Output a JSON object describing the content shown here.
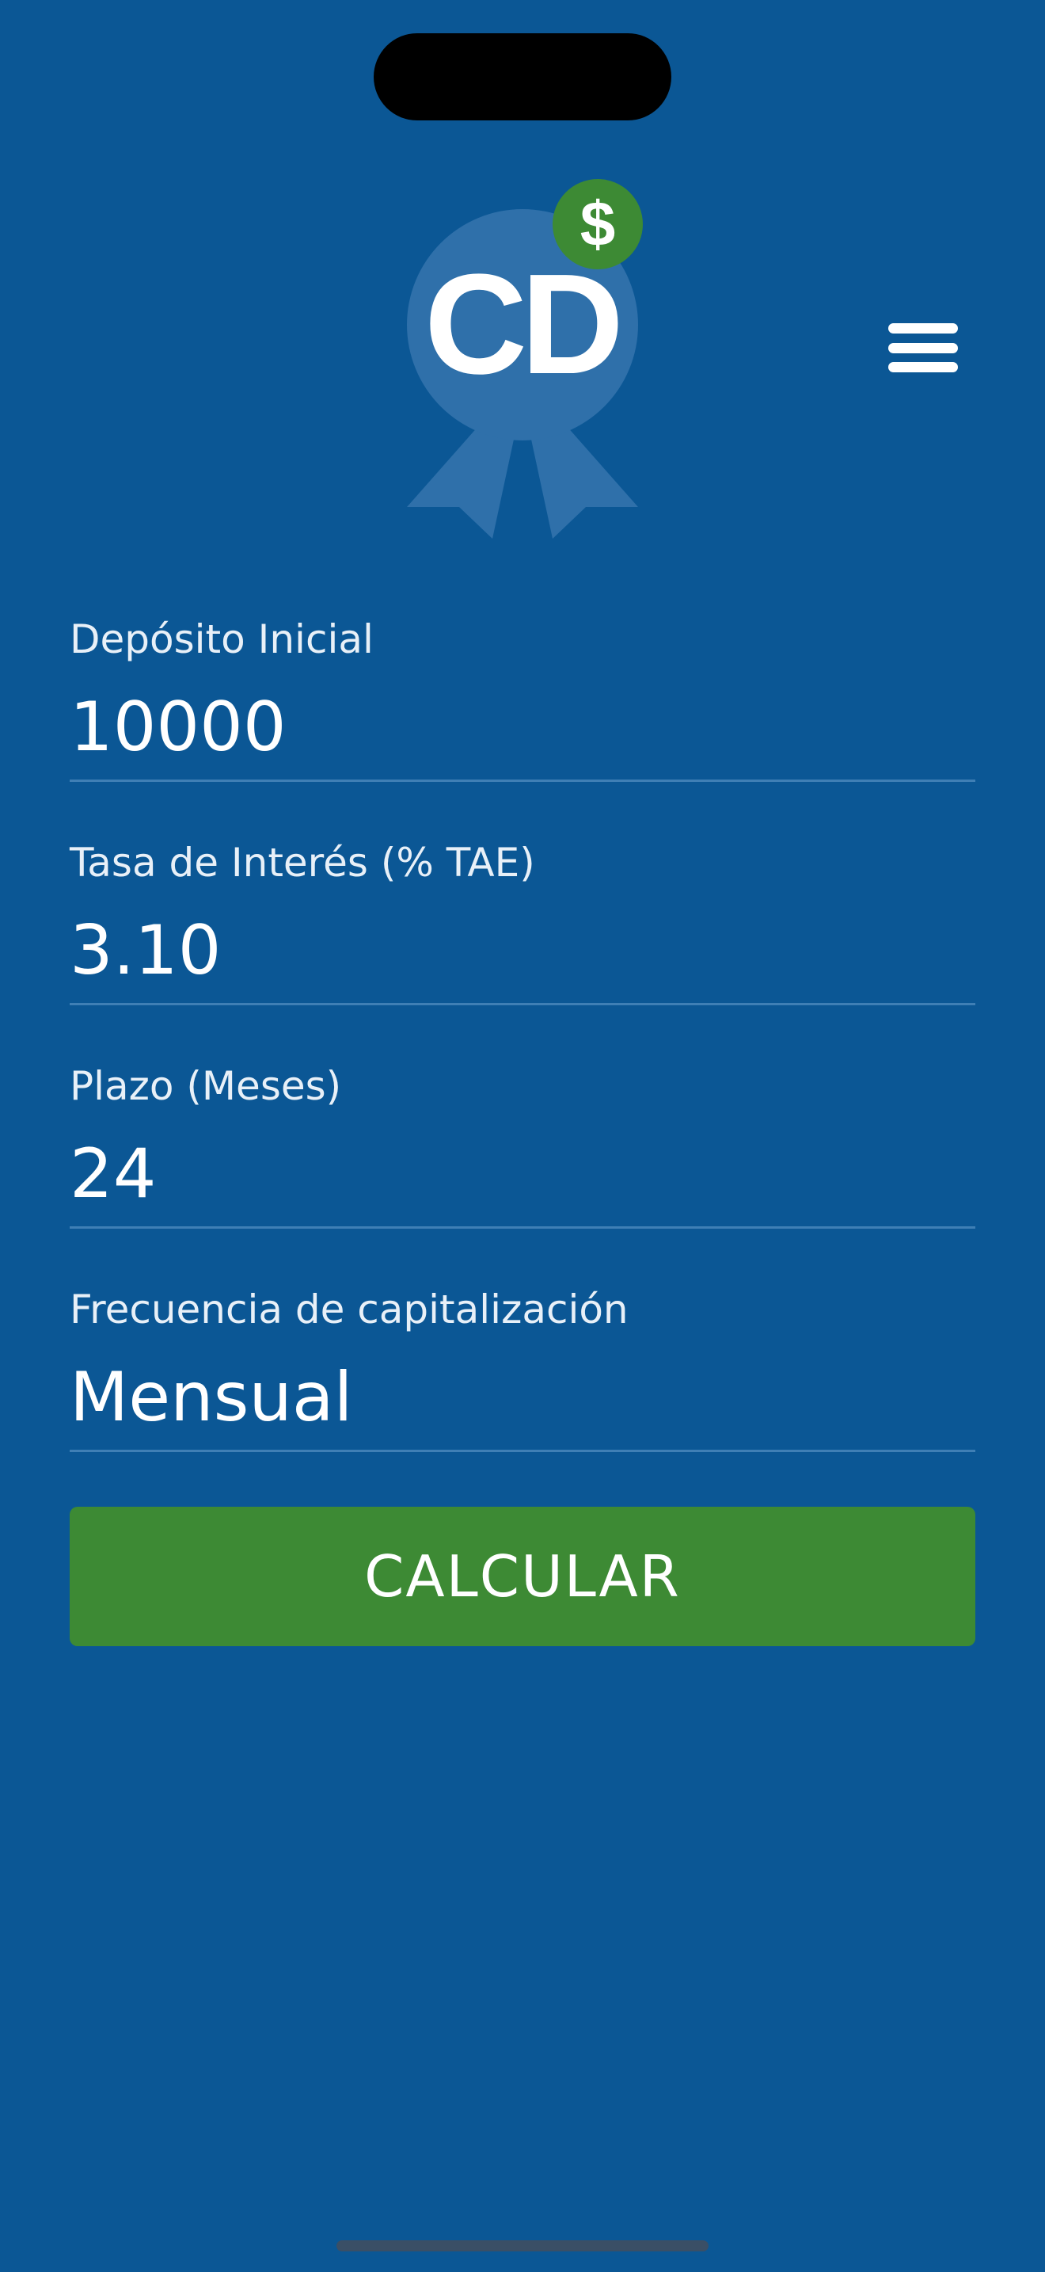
{
  "app": {
    "logo_text": "CD",
    "badge_symbol": "$",
    "colors": {
      "background": "#0b5795",
      "accent_green": "#3d8a34",
      "logo_circle": "#2f70aa",
      "underline": "#3f7fb5"
    }
  },
  "header": {
    "menu_icon": "hamburger-menu-icon"
  },
  "form": {
    "initial_deposit": {
      "label": "Depósito Inicial",
      "value": "10000"
    },
    "interest_rate": {
      "label": "Tasa de Interés (% TAE)",
      "value": "3.10"
    },
    "term": {
      "label": "Plazo (Meses)",
      "value": "24"
    },
    "compounding": {
      "label": "Frecuencia de capitalización",
      "value": "Mensual"
    }
  },
  "actions": {
    "calculate_label": "CALCULAR"
  }
}
